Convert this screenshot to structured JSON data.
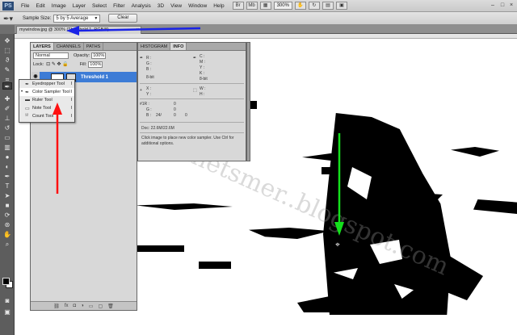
{
  "app": {
    "logo": "PS"
  },
  "menu": [
    "File",
    "Edit",
    "Image",
    "Layer",
    "Select",
    "Filter",
    "Analysis",
    "3D",
    "View",
    "Window",
    "Help"
  ],
  "menu_right": {
    "zoom": "300%"
  },
  "options": {
    "sample_size_label": "Sample Size:",
    "sample_size_value": "5 by 5 Average",
    "clear_label": "Clear"
  },
  "document": {
    "tab_label": "mywindow.jpg @ 300% (Threshold 1, RGB/8)"
  },
  "layers_panel": {
    "tabs": [
      "LAYERS",
      "CHANNELS",
      "PATHS"
    ],
    "blend_mode": "Normal",
    "opacity_label": "Opacity:",
    "opacity_value": "100%",
    "lock_label": "Lock:",
    "fill_label": "Fill:",
    "fill_value": "100%",
    "selected_layer": "Threshold 1"
  },
  "tool_flyout": {
    "items": [
      {
        "label": "Eyedropper Tool",
        "key": "I",
        "icon": "eyedropper-icon"
      },
      {
        "label": "Color Sampler Tool",
        "key": "I",
        "icon": "color-sampler-icon"
      },
      {
        "label": "Ruler Tool",
        "key": "I",
        "icon": "ruler-icon"
      },
      {
        "label": "Note Tool",
        "key": "I",
        "icon": "note-icon"
      },
      {
        "label": "Count Tool",
        "key": "I",
        "icon": "count-icon"
      }
    ]
  },
  "info_panel": {
    "tabs": [
      "HISTOGRAM",
      "INFO"
    ],
    "rgb_labels": [
      "R :",
      "G :",
      "B :"
    ],
    "cmyk_labels": [
      "C :",
      "M :",
      "Y :",
      "K :"
    ],
    "bit_label_left": "8-bit",
    "bit_label_right": "8-bit",
    "xy_labels": [
      "X :",
      "Y :"
    ],
    "wh_labels": [
      "W :",
      "H :"
    ],
    "sample1": {
      "label": "#1R :",
      "g": "G :",
      "b": "B :",
      "v1": "0",
      "v2": "0",
      "v3": "0",
      "v4": "24/",
      "v5": "0"
    },
    "doc_size": "Doc: 22.6M/22.6M",
    "help_text": "Click image to place new color sampler.  Use Ctrl for additional options."
  },
  "watermark": "jeanetsmer..blogspot.com",
  "colors": {
    "annotation_blue": "#1a23e6",
    "annotation_red": "#ff1010",
    "annotation_green": "#14e01c",
    "layer_selected": "#3d7cd6"
  }
}
